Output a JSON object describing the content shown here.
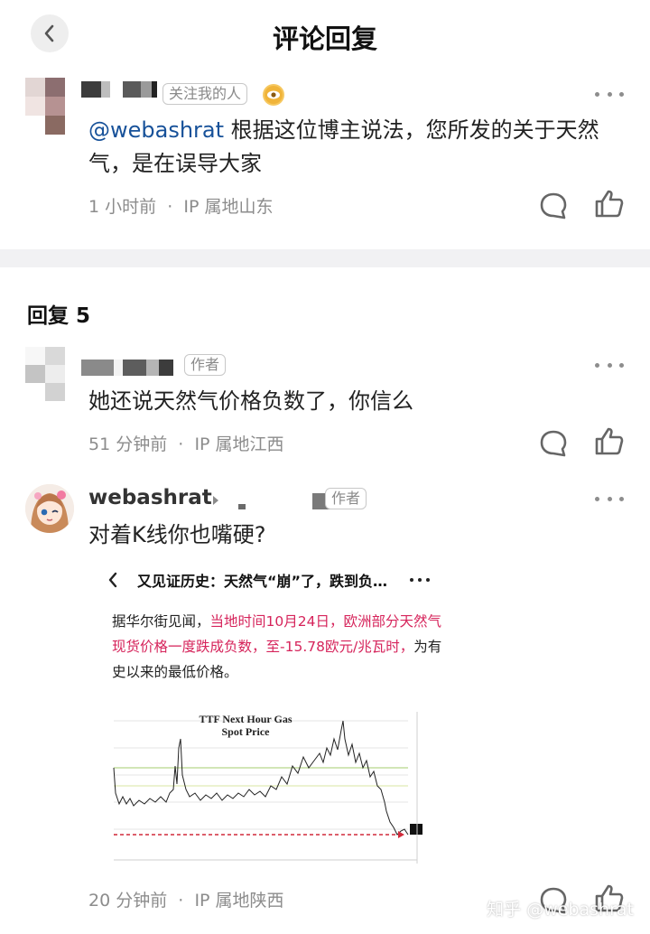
{
  "header": {
    "title": "评论回复"
  },
  "top_comment": {
    "tag": "关注我的人",
    "mention": "@webashrat",
    "text": " 根据这位博主说法，您所发的关于天然气，是在误导大家",
    "time": "1 小时前",
    "location": "IP 属地山东"
  },
  "replies_section": {
    "title": "回复 5"
  },
  "replies": [
    {
      "tag": "作者",
      "text": "她还说天然气价格负数了，你信么",
      "time": "51 分钟前",
      "location": "IP 属地江西"
    },
    {
      "username": "webashrat",
      "tag": "作者",
      "text": "对着K线你也嘴硬?",
      "time": "20 分钟前",
      "location": "IP 属地陕西",
      "embedded": {
        "title": "又见证历史：天然气“崩”了，跌到负…",
        "text_prefix": "据华尔街见闻，",
        "text_highlight": "当地时间10月24日，欧洲部分天然气现货价格一度跌成负数，至-15.78欧元/兆瓦时，",
        "text_suffix": "为有史以来的最低价格。",
        "chart_title_1": "TTF Next Hour Gas",
        "chart_title_2": "Spot Price"
      }
    }
  ],
  "watermark": "知乎 @webashrat",
  "colors": {
    "mention": "#175199",
    "highlight": "#d6245b",
    "meta": "#8c8c8c"
  }
}
